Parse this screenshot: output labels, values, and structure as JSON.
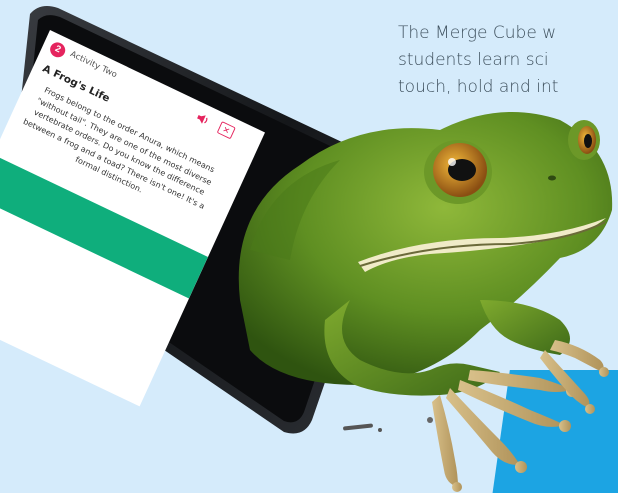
{
  "promo": {
    "line1": "The Merge Cube w",
    "line2": "students learn sci",
    "line3": "touch, hold and int"
  },
  "app": {
    "step_number": "2",
    "title": "Activity Two",
    "article_title": "A Frog's Life",
    "article_body": "Frogs belong to the order Anura, which means \"without tail\". They are one of the most diverse vertebrate orders. Do you know the difference between a frog and a toad? There isn't one! It's a formal distinction.",
    "close_glyph": "✕"
  },
  "icons": {
    "audio": "speaker-icon",
    "close": "close-icon"
  },
  "colors": {
    "background": "#d5ebfb",
    "accent_blue": "#1ca4e3",
    "badge_pink": "#e5245e",
    "screen_green": "#0fae7c"
  }
}
